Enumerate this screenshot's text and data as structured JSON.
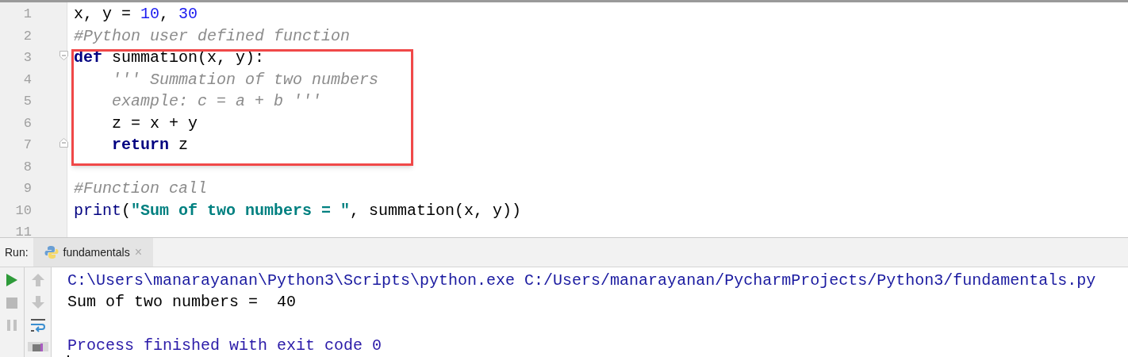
{
  "editor": {
    "lines": [
      {
        "number": "1",
        "tokens": [
          {
            "kind": "plain",
            "text": "x, y = "
          },
          {
            "kind": "number",
            "text": "10"
          },
          {
            "kind": "plain",
            "text": ", "
          },
          {
            "kind": "number",
            "text": "30"
          }
        ]
      },
      {
        "number": "2",
        "tokens": [
          {
            "kind": "comment",
            "text": "#Python user defined function"
          }
        ]
      },
      {
        "number": "3",
        "fold_start": true,
        "tokens": [
          {
            "kind": "keyword",
            "text": "def"
          },
          {
            "kind": "plain",
            "text": " summation(x, y):"
          }
        ]
      },
      {
        "number": "4",
        "tokens": [
          {
            "kind": "docstring",
            "text": "    ''' Summation of two numbers"
          }
        ]
      },
      {
        "number": "5",
        "tokens": [
          {
            "kind": "docstring",
            "text": "    example: c = a + b '''"
          }
        ]
      },
      {
        "number": "6",
        "tokens": [
          {
            "kind": "plain",
            "text": "    z = x + y"
          }
        ]
      },
      {
        "number": "7",
        "fold_end": true,
        "tokens": [
          {
            "kind": "keyword",
            "text": "    return"
          },
          {
            "kind": "plain",
            "text": " z"
          }
        ]
      },
      {
        "number": "8"
      },
      {
        "number": "9",
        "tokens": [
          {
            "kind": "comment",
            "text": "#Function call"
          }
        ]
      },
      {
        "number": "10",
        "tokens": [
          {
            "kind": "builtin",
            "text": "print"
          },
          {
            "kind": "plain",
            "text": "("
          },
          {
            "kind": "string",
            "text": "\"Sum of two numbers = \""
          },
          {
            "kind": "plain",
            "text": ", summation(x, y))"
          }
        ]
      },
      {
        "number": "11"
      }
    ]
  },
  "run_panel": {
    "label": "Run:",
    "tabs": [
      {
        "label": "fundamentals",
        "close": "×",
        "selected": true
      }
    ],
    "console": [
      {
        "kind": "command",
        "text": "C:\\Users\\manarayanan\\Python3\\Scripts\\python.exe C:/Users/manarayanan/PycharmProjects/Python3/fundamentals.py"
      },
      {
        "kind": "output",
        "text": "Sum of two numbers =  40"
      },
      {
        "kind": "blank"
      },
      {
        "kind": "system",
        "text": "Process finished with exit code 0"
      }
    ]
  }
}
